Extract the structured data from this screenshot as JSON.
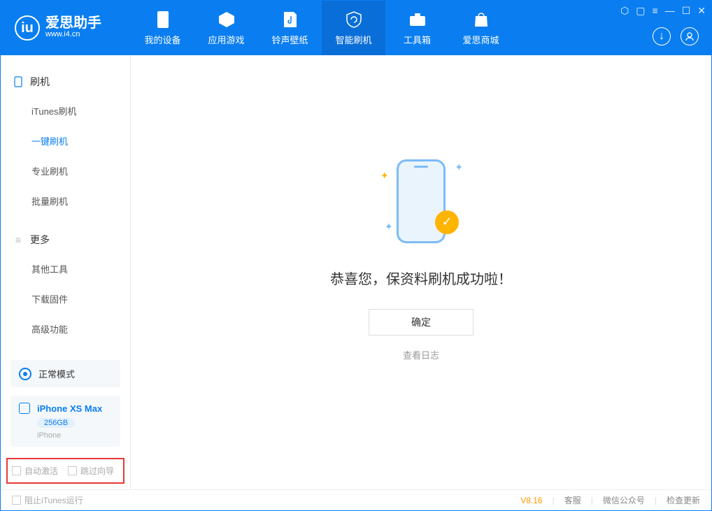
{
  "app": {
    "title": "爱思助手",
    "subtitle": "www.i4.cn"
  },
  "nav": {
    "items": [
      {
        "label": "我的设备"
      },
      {
        "label": "应用游戏"
      },
      {
        "label": "铃声壁纸"
      },
      {
        "label": "智能刷机"
      },
      {
        "label": "工具箱"
      },
      {
        "label": "爱思商城"
      }
    ]
  },
  "sidebar": {
    "group1": {
      "title": "刷机",
      "items": [
        "iTunes刷机",
        "一键刷机",
        "专业刷机",
        "批量刷机"
      ]
    },
    "group2": {
      "title": "更多",
      "items": [
        "其他工具",
        "下载固件",
        "高级功能"
      ]
    }
  },
  "mode": {
    "label": "正常模式"
  },
  "device": {
    "name": "iPhone XS Max",
    "capacity": "256GB",
    "type": "iPhone"
  },
  "options": {
    "auto_activate": "自动激活",
    "skip_guide": "跳过向导"
  },
  "main": {
    "success_text": "恭喜您，保资料刷机成功啦！",
    "ok_button": "确定",
    "view_log": "查看日志"
  },
  "footer": {
    "block_itunes": "阻止iTunes运行",
    "version": "V8.16",
    "links": [
      "客服",
      "微信公众号",
      "检查更新"
    ]
  }
}
